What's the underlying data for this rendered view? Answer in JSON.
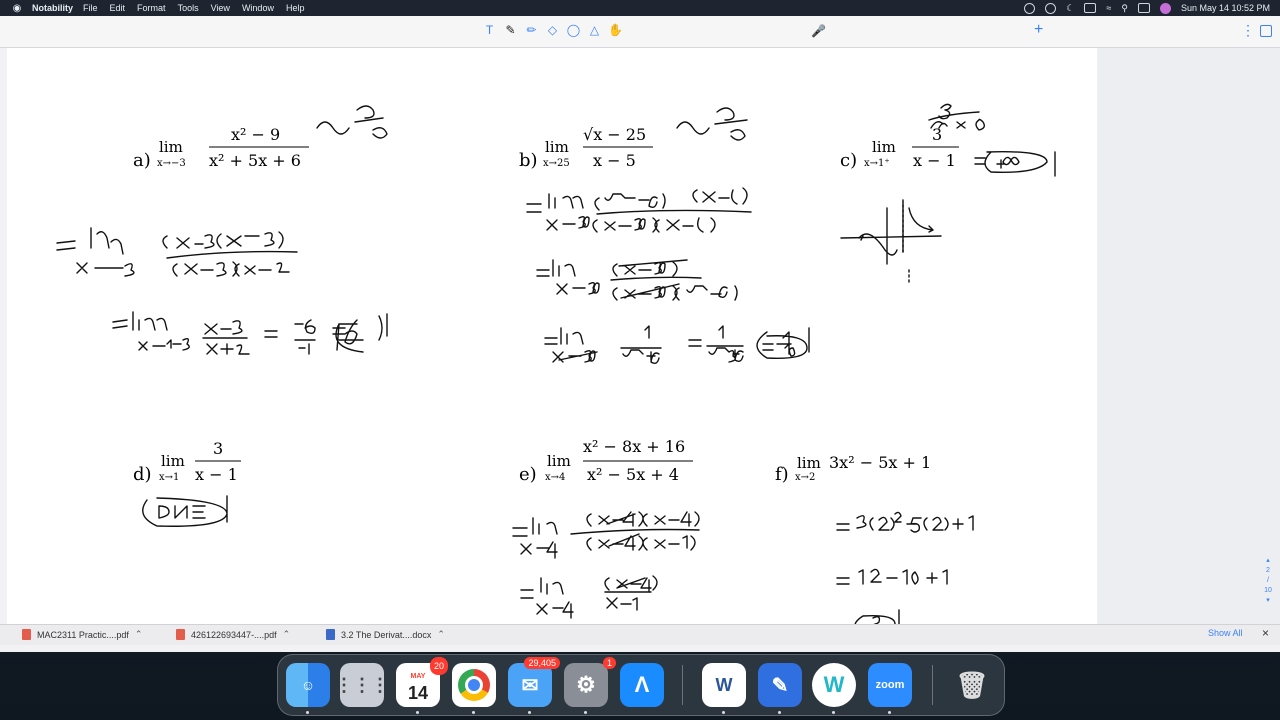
{
  "menubar": {
    "app": "Notability",
    "items": [
      "File",
      "Edit",
      "Format",
      "Tools",
      "View",
      "Window",
      "Help"
    ],
    "datetime": "Sun May 14  10:52 PM"
  },
  "toolbar": {
    "tools": [
      "text-tool",
      "pen-tool",
      "highlighter-tool",
      "eraser-tool",
      "lasso-tool",
      "shapes-tool",
      "hand-tool"
    ]
  },
  "page_nav": {
    "current": "2",
    "total": "10"
  },
  "problems": {
    "a": {
      "label": "a)"
    },
    "b": {
      "label": "b)"
    },
    "c": {
      "label": "c)"
    },
    "d": {
      "label": "d)"
    },
    "e": {
      "label": "e)"
    },
    "f": {
      "label": "f)"
    }
  },
  "downloads": {
    "files": [
      "MAC2311 Practic....pdf",
      "426122693447-....pdf",
      "3.2 The Derivat....docx"
    ],
    "show_all": "Show All"
  },
  "dock": {
    "calendar_month": "MAY",
    "calendar_day": "14",
    "calendar_badge": "20",
    "mail_badge": "29,405",
    "settings_badge": "1",
    "word_label": "W",
    "zoom_label": "zoom",
    "w_label": "W"
  }
}
